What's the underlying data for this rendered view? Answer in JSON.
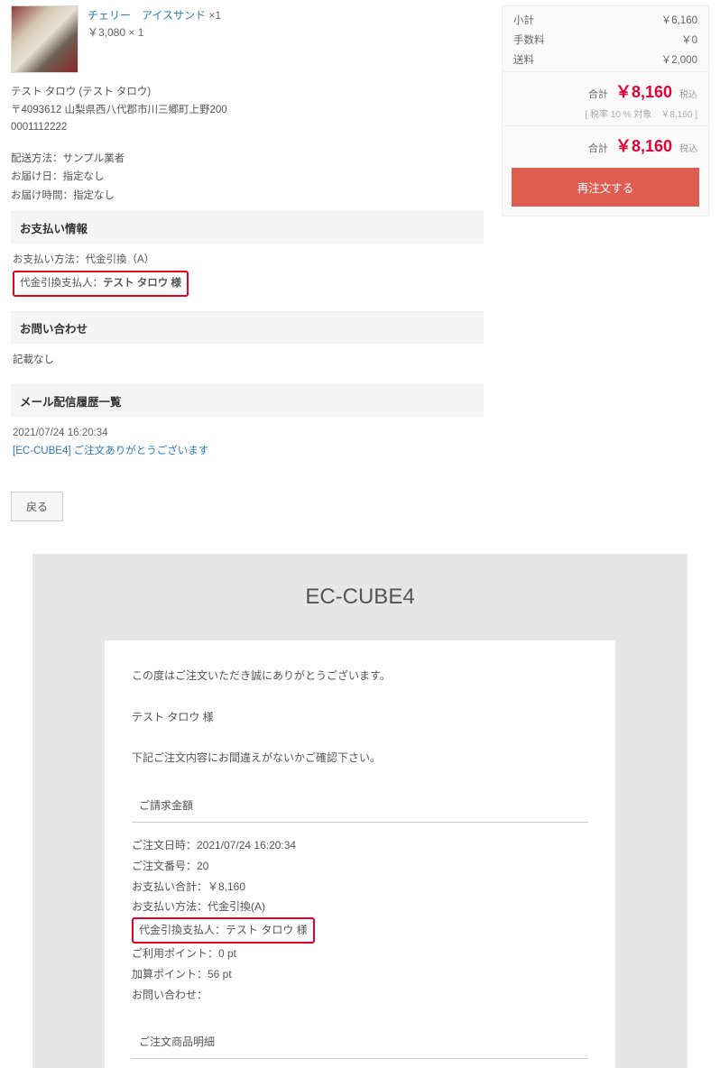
{
  "product": {
    "name": "チェリー　アイスサンド",
    "qty_suffix": " ×1",
    "price_line": "￥3,080 × 1"
  },
  "shipping": {
    "name": "テスト タロウ (テスト タロウ)",
    "address": "〒4093612 山梨県西八代郡市川三郷町上野200",
    "phone": "0001112222",
    "method": "配送方法：サンプル業者",
    "date": "お届け日：指定なし",
    "time": "お届け時間：指定なし"
  },
  "sections": {
    "payment_header": "お支払い情報",
    "payment_method": "お支払い方法：代金引換（A）",
    "payment_payer_prefix": "代金引換支払人：",
    "payment_payer_name": "テスト タロウ 様",
    "contact_header": "お問い合わせ",
    "contact_body": "記載なし",
    "mail_header": "メール配信履歴一覧",
    "mail_date": "2021/07/24 16:20:34",
    "mail_link": "[EC-CUBE4] ご注文ありがとうございます"
  },
  "back_label": "戻る",
  "summary": {
    "subtotal_lbl": "小計",
    "subtotal_val": "￥6,160",
    "fee_lbl": "手数料",
    "fee_val": "￥0",
    "ship_lbl": "送料",
    "ship_val": "￥2,000",
    "total_lbl": "合計",
    "total_val": "￥8,160",
    "tax_lbl": "税込",
    "tax_detail": "[ 税率 10 % 対象　￥8,160 ]",
    "grand_lbl": "合計",
    "grand_val": "￥8,160",
    "grand_tax": "税込",
    "reorder": "再注文する"
  },
  "email": {
    "title": "EC-CUBE4",
    "greeting": "この度はご注文いただき誠にありがとうございます。",
    "customer": "テスト タロウ 様",
    "confirm": "下記ご注文内容にお間違えがないかご確認下さい。",
    "sec_bill": "ご請求金額",
    "order_date": "ご注文日時：2021/07/24 16:20:34",
    "order_no": "ご注文番号：20",
    "pay_total": "お支払い合計：￥8,160",
    "pay_method": "お支払い方法：代金引換(A)",
    "payer": "代金引換支払人：テスト タロウ 様",
    "use_pt": "ご利用ポイント：0 pt",
    "add_pt": "加算ポイント：56 pt",
    "contact": "お問い合わせ：",
    "sec_items": "ご注文商品明細"
  }
}
